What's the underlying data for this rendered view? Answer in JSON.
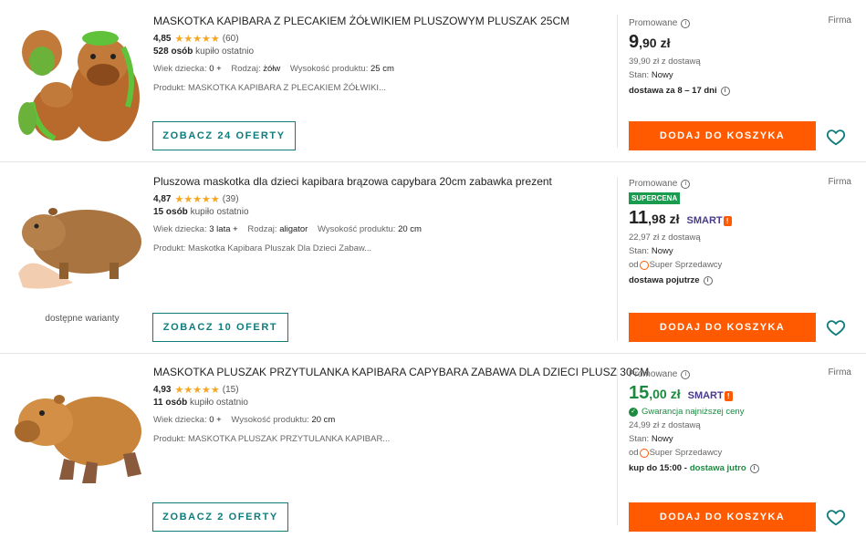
{
  "products": [
    {
      "title": "MASKOTKA KAPIBARA Z PLECAKIEM ŻÓŁWIKIEM PLUSZOWYM PLUSZAK 25CM",
      "rating": "4,85",
      "reviews": "(60)",
      "bought_count": "528 osób",
      "bought_label": "kupiło ostatnio",
      "params": [
        {
          "label": "Wiek dziecka:",
          "value": "0 +"
        },
        {
          "label": "Rodzaj:",
          "value": "żółw"
        },
        {
          "label": "Wysokość produktu:",
          "value": "25 cm"
        }
      ],
      "desc": "Produkt: MASKOTKA KAPIBARA Z PLECAKIEM ŻÓŁWIKI...",
      "offers_button": "ZOBACZ 24 OFERTY",
      "promo": "Promowane",
      "firma": "Firma",
      "price_int": "9",
      "price_dec": ",90",
      "currency": "zł",
      "with_delivery": "39,90 zł z dostawą",
      "condition_label": "Stan:",
      "condition": "Nowy",
      "delivery": "dostawa za 8 – 17 dni",
      "cart_button": "DODAJ DO KOSZYKA",
      "image_desc": "capybara-with-turtle-backpack"
    },
    {
      "title": "Pluszowa maskotka dla dzieci kapibara brązowa capybara 20cm zabawka prezent",
      "rating": "4,87",
      "reviews": "(39)",
      "bought_count": "15 osób",
      "bought_label": "kupiło ostatnio",
      "params": [
        {
          "label": "Wiek dziecka:",
          "value": "3 lata +"
        },
        {
          "label": "Rodzaj:",
          "value": "aligator"
        },
        {
          "label": "Wysokość produktu:",
          "value": "20 cm"
        }
      ],
      "desc": "Produkt: Maskotka Kapibara Pluszak Dla Dzieci Zabaw...",
      "variants": "dostępne warianty",
      "offers_button": "ZOBACZ 10 OFERT",
      "promo": "Promowane",
      "firma": "Firma",
      "badge": "SUPERCENA",
      "price_int": "11",
      "price_dec": ",98",
      "currency": "zł",
      "smart": "SMART",
      "with_delivery": "22,97 zł z dostawą",
      "condition_label": "Stan:",
      "condition": "Nowy",
      "seller_prefix": "od",
      "seller": "Super Sprzedawcy",
      "delivery": "dostawa pojutrze",
      "cart_button": "DODAJ DO KOSZYKA",
      "image_desc": "capybara-in-hand"
    },
    {
      "title": "MASKOTKA PLUSZAK PRZYTULANKA KAPIBARA CAPYBARA ZABAWA DLA DZIECI PLUSZ 30CM",
      "rating": "4,93",
      "reviews": "(15)",
      "bought_count": "11 osób",
      "bought_label": "kupiło ostatnio",
      "params": [
        {
          "label": "Wiek dziecka:",
          "value": "0 +"
        },
        {
          "label": "Wysokość produktu:",
          "value": "20 cm"
        }
      ],
      "desc": "Produkt: MASKOTKA PLUSZAK PRZYTULANKA KAPIBAR...",
      "offers_button": "ZOBACZ 2 OFERTY",
      "promo": "Promowane",
      "firma": "Firma",
      "price_int": "15",
      "price_dec": ",00",
      "currency": "zł",
      "smart": "SMART",
      "guarantee": "Gwarancja najniższej ceny",
      "with_delivery": "24,99 zł z dostawą",
      "condition_label": "Stan:",
      "condition": "Nowy",
      "seller_prefix": "od",
      "seller": "Super Sprzedawcy",
      "delivery_prefix": "kup do 15:00 -",
      "delivery": "dostawa jutro",
      "cart_button": "DODAJ DO KOSZYKA",
      "image_desc": "capybara-plush-standing"
    }
  ],
  "colors": {
    "accent": "#ff5a00",
    "teal": "#0f7c7c",
    "green": "#1b8a3e",
    "star": "#f5a623"
  }
}
